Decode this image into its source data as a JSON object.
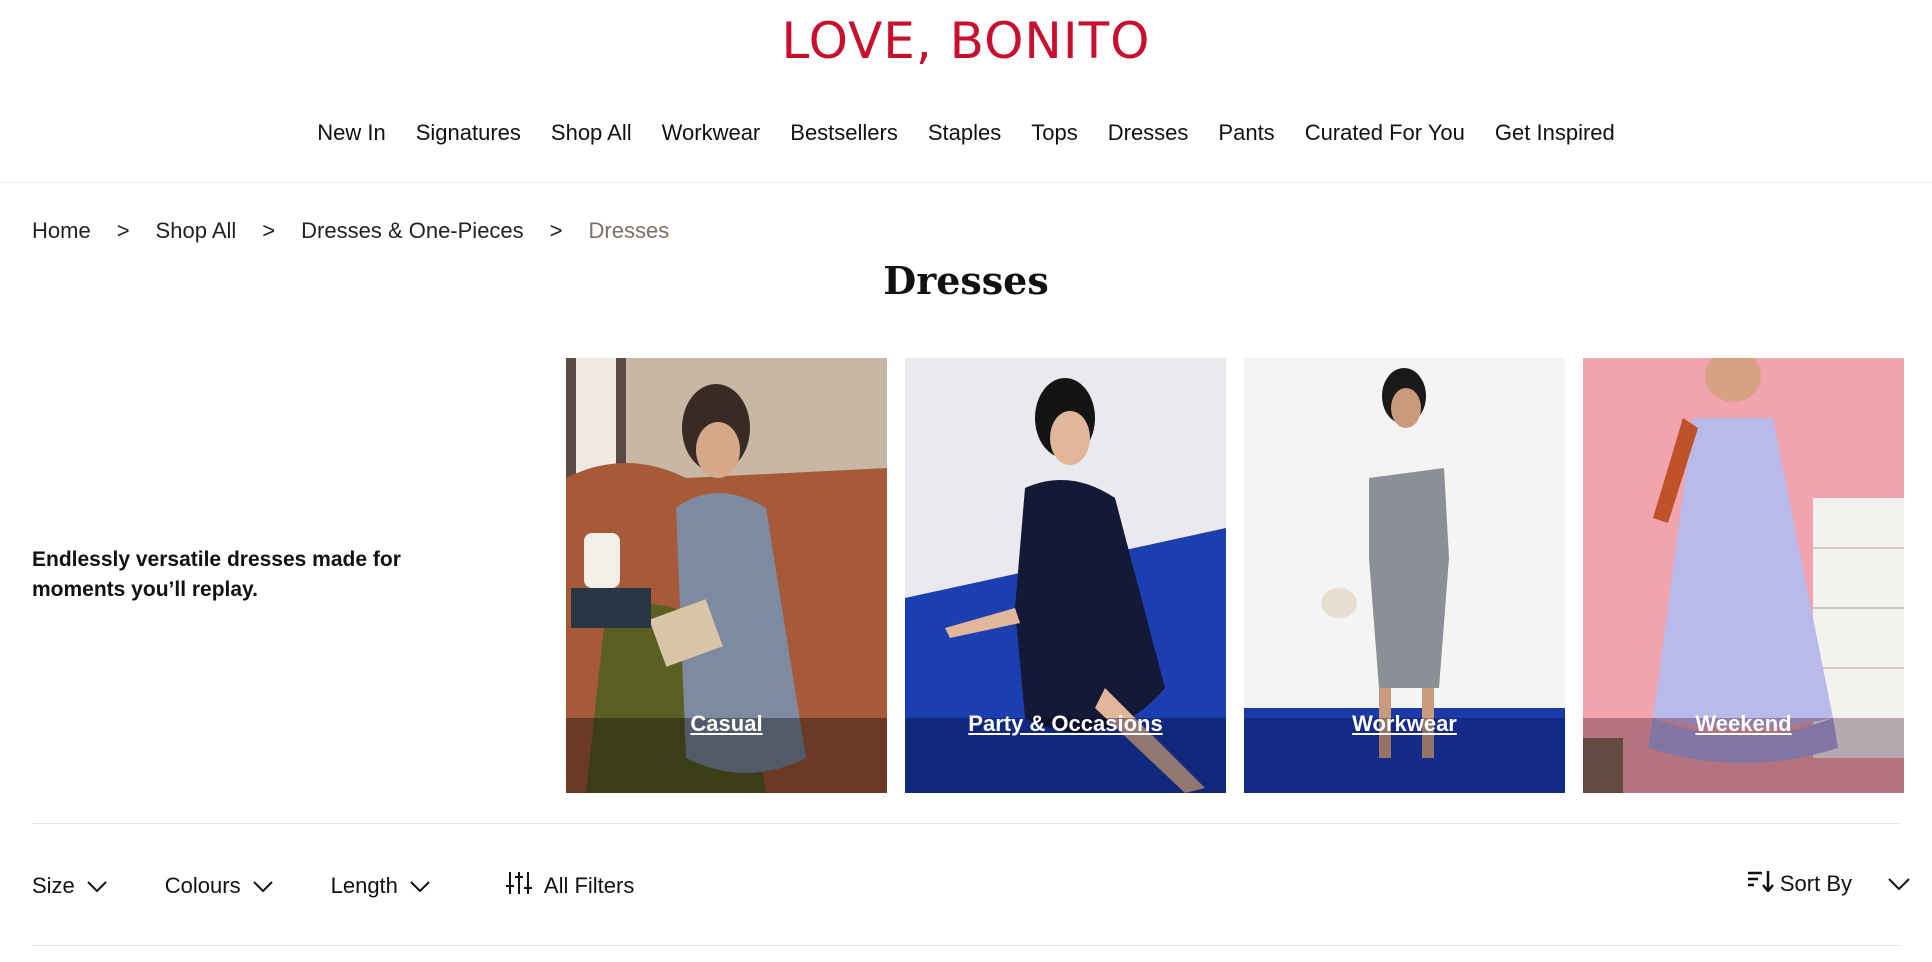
{
  "brand": {
    "logo_text": "LOVE, BONITO",
    "color": "#c8102e"
  },
  "nav": {
    "items": [
      "New In",
      "Signatures",
      "Shop All",
      "Workwear",
      "Bestsellers",
      "Staples",
      "Tops",
      "Dresses",
      "Pants",
      "Curated For You",
      "Get Inspired"
    ]
  },
  "breadcrumb": {
    "items": [
      "Home",
      "Shop All",
      "Dresses & One-Pieces",
      "Dresses"
    ],
    "separator": ">"
  },
  "page": {
    "title": "Dresses",
    "tagline": "Endlessly versatile dresses made for moments you’ll replay."
  },
  "categories": [
    {
      "label": "Casual",
      "image": "woman-lounging-grey-slip-dress"
    },
    {
      "label": "Party & Occasions",
      "image": "woman-seated-navy-halter-dress"
    },
    {
      "label": "Workwear",
      "image": "woman-standing-grey-strapless-dress"
    },
    {
      "label": "Weekend",
      "image": "woman-lilac-tiered-halter-dress"
    }
  ],
  "filters": {
    "size": "Size",
    "colours": "Colours",
    "length": "Length",
    "all_filters": "All Filters",
    "sort_by": "Sort By"
  },
  "icons": {
    "chevron": "chevron-down-icon",
    "filters": "sliders-icon",
    "sort": "sort-icon"
  }
}
